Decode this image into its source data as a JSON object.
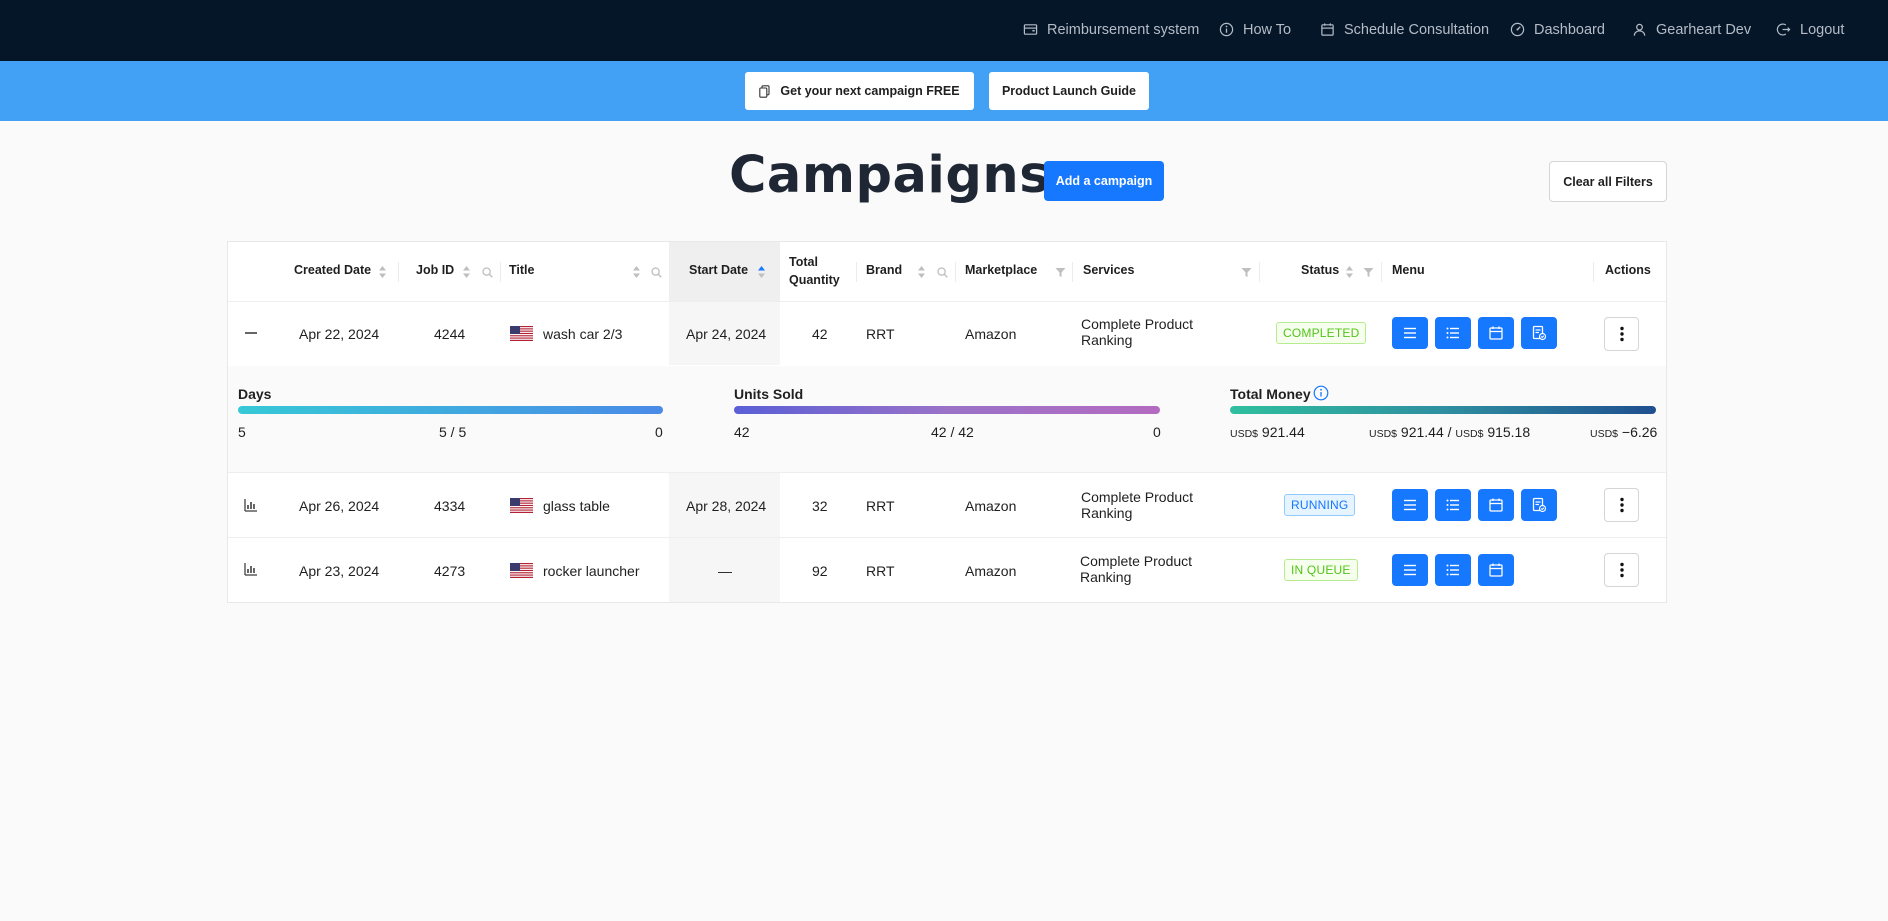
{
  "nav": {
    "items": [
      {
        "label": "Reimbursement system",
        "icon": "wallet-icon"
      },
      {
        "label": "How To",
        "icon": "info-circle-icon"
      },
      {
        "label": "Schedule Consultation",
        "icon": "calendar-icon"
      },
      {
        "label": "Dashboard",
        "icon": "dashboard-icon"
      },
      {
        "label": "Gearheart Dev",
        "icon": "user-icon"
      },
      {
        "label": "Logout",
        "icon": "logout-icon"
      }
    ]
  },
  "promo": {
    "campaign_label": "Get your next campaign FREE",
    "guide_label": "Product Launch Guide"
  },
  "header": {
    "title": "Campaigns",
    "add_label": "Add a campaign",
    "clear_label": "Clear all Filters"
  },
  "table": {
    "columns": {
      "created": "Created Date",
      "job": "Job ID",
      "title": "Title",
      "start": "Start Date",
      "qty1": "Total",
      "qty2": "Quantity",
      "brand": "Brand",
      "marketplace": "Marketplace",
      "services": "Services",
      "status": "Status",
      "menu": "Menu",
      "actions": "Actions"
    },
    "rows": [
      {
        "created": "Apr 22, 2024",
        "job": "4244",
        "title": "wash car 2/3",
        "start": "Apr 24, 2024",
        "qty": "42",
        "brand": "RRT",
        "marketplace": "Amazon",
        "services": "Complete Product Ranking",
        "status": "COMPLETED",
        "status_color": "#52c41a",
        "expanded": true
      },
      {
        "created": "Apr 26, 2024",
        "job": "4334",
        "title": "glass table",
        "start": "Apr 28, 2024",
        "qty": "32",
        "brand": "RRT",
        "marketplace": "Amazon",
        "services": "Complete Product Ranking",
        "status": "RUNNING",
        "status_color": "#1677ff",
        "expanded": false
      },
      {
        "created": "Apr 23, 2024",
        "job": "4273",
        "title": "rocker launcher",
        "start": "—",
        "qty": "92",
        "brand": "RRT",
        "marketplace": "Amazon",
        "services": "Complete Product Ranking",
        "status": "IN QUEUE",
        "status_color": "#52c41a",
        "expanded": false
      }
    ],
    "sorted_column": "Start Date",
    "sort_direction": "ascending"
  },
  "details": {
    "days": {
      "label": "Days",
      "start": "5",
      "progress": "5 / 5",
      "end": "0",
      "fill": 1.0
    },
    "units": {
      "label": "Units Sold",
      "start": "42",
      "progress": "42 / 42",
      "end": "0",
      "fill": 1.0
    },
    "money": {
      "label": "Total Money",
      "currency": "USD$",
      "start": "921.44",
      "progress_a": "921.44",
      "progress_sep": " / ",
      "progress_b": "915.18",
      "end": "−6.26",
      "fill": 1.0
    }
  },
  "colors": {
    "nav_bg": "#061629",
    "promo_bg": "#42a0f5",
    "primary": "#1677ff",
    "completed": "#52c41a",
    "running": "#1677ff"
  }
}
